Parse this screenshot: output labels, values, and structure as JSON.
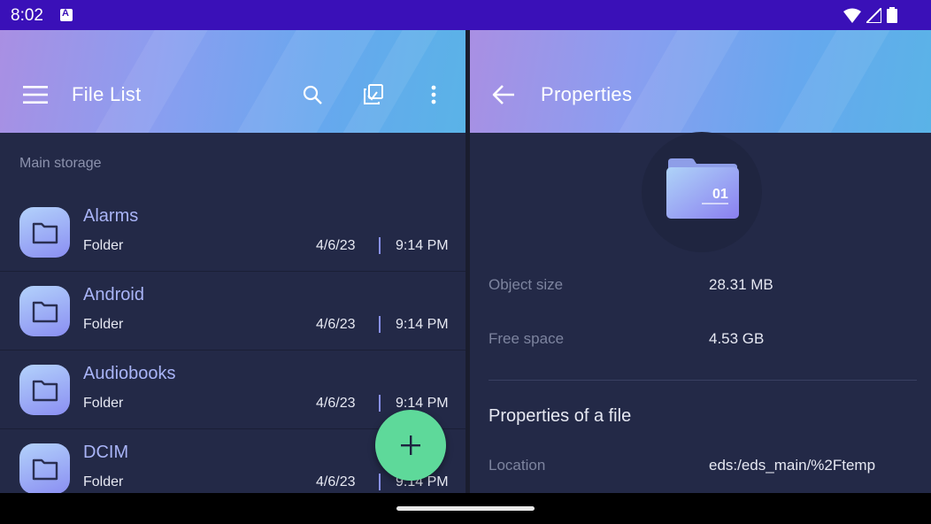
{
  "status_bar": {
    "time": "8:02"
  },
  "left_pane": {
    "title": "File List",
    "section": "Main storage",
    "items": [
      {
        "name": "Alarms",
        "type": "Folder",
        "date": "4/6/23",
        "time": "9:14 PM"
      },
      {
        "name": "Android",
        "type": "Folder",
        "date": "4/6/23",
        "time": "9:14 PM"
      },
      {
        "name": "Audiobooks",
        "type": "Folder",
        "date": "4/6/23",
        "time": "9:14 PM"
      },
      {
        "name": "DCIM",
        "type": "Folder",
        "date": "4/6/23",
        "time": "9:14 PM"
      }
    ]
  },
  "right_pane": {
    "title": "Properties",
    "folder_badge": "01",
    "object_size_label": "Object size",
    "object_size_value": "28.31 MB",
    "free_space_label": "Free space",
    "free_space_value": "4.53 GB",
    "section_title": "Properties of a file",
    "location_label": "Location",
    "location_value": "eds:/eds_main/%2Ftemp"
  },
  "colors": {
    "accent": "#5ed99a",
    "status_bar": "#3a10b8",
    "background": "#232947"
  }
}
